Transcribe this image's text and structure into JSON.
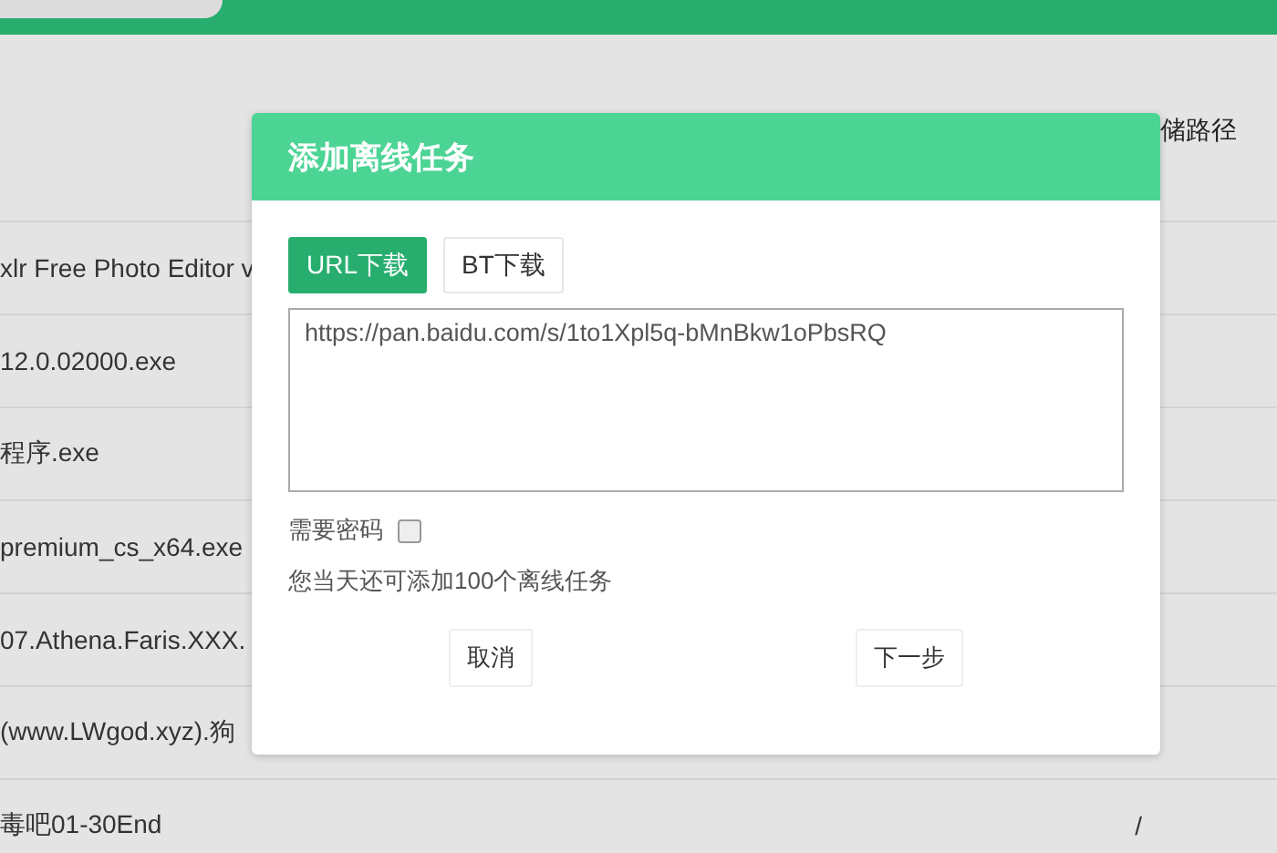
{
  "top_tab": {
    "kind": "tab"
  },
  "table": {
    "header": {
      "column_3": "储路径"
    },
    "rows": [
      {
        "name": "xlr Free Photo Editor v"
      },
      {
        "name": "12.0.02000.exe"
      },
      {
        "name": "程序.exe"
      },
      {
        "name": "premium_cs_x64.exe"
      },
      {
        "name": "07.Athena.Faris.XXX."
      },
      {
        "name": "(www.LWgod.xyz).狗"
      },
      {
        "name": "毒吧01-30End",
        "path": "/"
      }
    ]
  },
  "dialog": {
    "title": "添加离线任务",
    "tabs": [
      {
        "label": "URL下载",
        "selected": true
      },
      {
        "label": "BT下载",
        "selected": false
      }
    ],
    "url_field": {
      "value": "https://pan.baidu.com/s/1to1Xpl5q-bMnBkw1oPbsRQ"
    },
    "password": {
      "label": "需要密码",
      "checked": false
    },
    "notice": "您当天还可添加100个离线任务",
    "buttons": [
      {
        "label": "取消"
      },
      {
        "label": "下一步"
      }
    ]
  }
}
